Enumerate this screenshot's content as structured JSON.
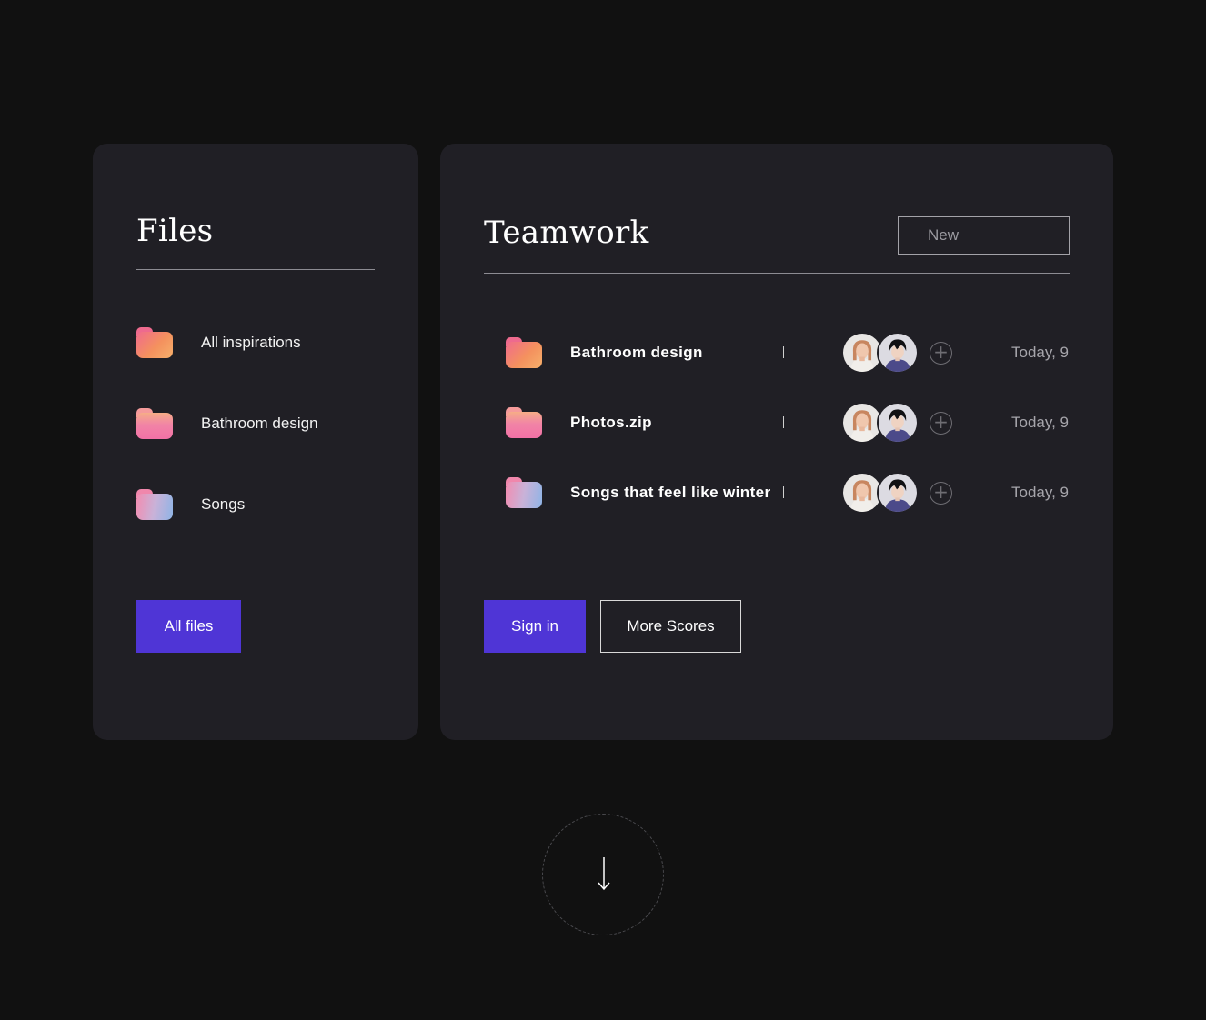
{
  "files": {
    "title": "Files",
    "items": [
      {
        "label": "All inspirations",
        "icon": "folder-icon"
      },
      {
        "label": "Bathroom design",
        "icon": "folder-icon"
      },
      {
        "label": "Songs",
        "icon": "folder-icon"
      }
    ],
    "all_files_label": "All files"
  },
  "teamwork": {
    "title": "Teamwork",
    "new_placeholder": "New",
    "rows": [
      {
        "name": "Bathroom design",
        "date": "Today, 9:"
      },
      {
        "name": "Photos.zip",
        "date": "Today, 9:"
      },
      {
        "name": "Songs that feel like winter",
        "date": "Today, 9:"
      }
    ],
    "add_member_symbol": "+",
    "sign_in_label": "Sign in",
    "more_scores_label": "More Scores"
  },
  "colors": {
    "background": "#111111",
    "panel": "#201f25",
    "accent": "#4f35d6"
  },
  "icons": {
    "scroll": "arrow-down-icon",
    "add": "plus-circle-icon"
  }
}
